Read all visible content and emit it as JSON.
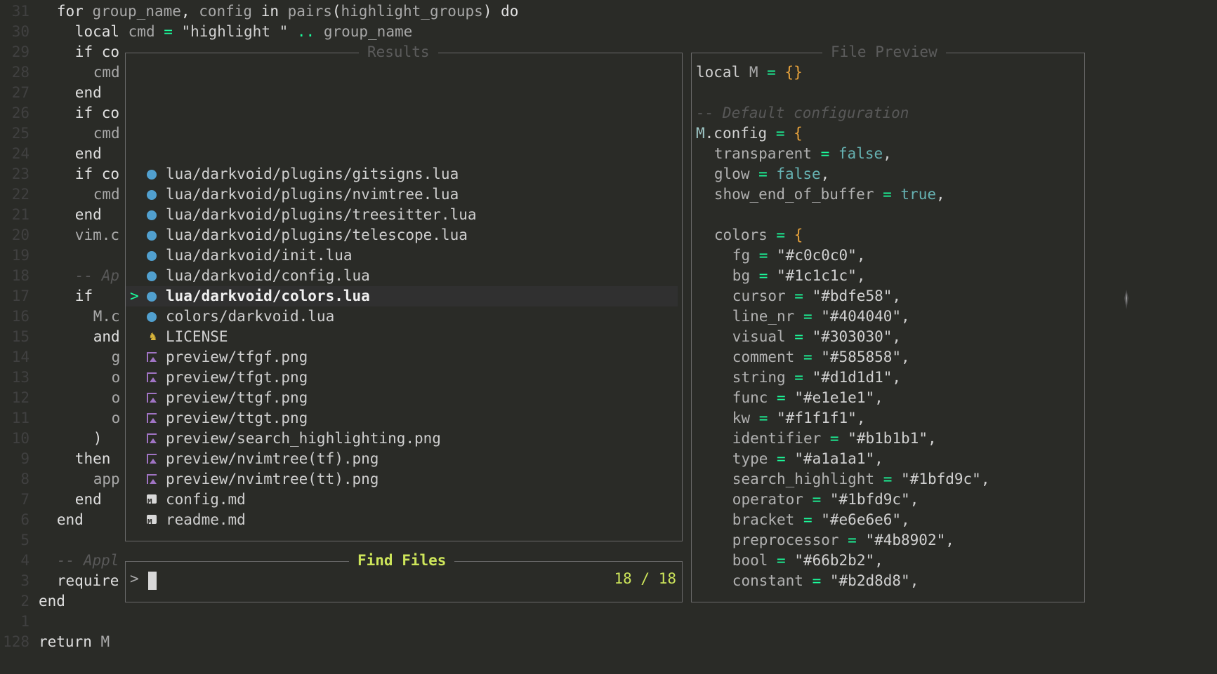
{
  "editor": {
    "lines": [
      {
        "num": "31",
        "indent": 1,
        "parts": [
          [
            "for ",
            ""
          ],
          [
            "group_name",
            "c-gray"
          ],
          [
            ", ",
            ""
          ],
          [
            "config",
            "c-gray"
          ],
          [
            " in ",
            ""
          ],
          [
            "pairs",
            "c-gray"
          ],
          [
            "(",
            ""
          ],
          [
            "highlight_groups",
            "c-gray"
          ],
          [
            ") do",
            ""
          ]
        ]
      },
      {
        "num": "30",
        "indent": 2,
        "parts": [
          [
            "local ",
            ""
          ],
          [
            "cmd",
            "c-gray"
          ],
          [
            " = ",
            "c-op"
          ],
          [
            "\"highlight \"",
            "c-str"
          ],
          [
            " .. ",
            "c-op"
          ],
          [
            "group_name",
            "c-gray"
          ]
        ]
      },
      {
        "num": "29",
        "indent": 2,
        "parts": [
          [
            "if co",
            ""
          ]
        ]
      },
      {
        "num": "28",
        "indent": 3,
        "parts": [
          [
            "cmd",
            "c-gray"
          ]
        ]
      },
      {
        "num": "27",
        "indent": 2,
        "parts": [
          [
            "end",
            ""
          ]
        ]
      },
      {
        "num": "26",
        "indent": 2,
        "parts": [
          [
            "if co",
            ""
          ]
        ]
      },
      {
        "num": "25",
        "indent": 3,
        "parts": [
          [
            "cmd",
            "c-gray"
          ]
        ]
      },
      {
        "num": "24",
        "indent": 2,
        "parts": [
          [
            "end",
            ""
          ]
        ]
      },
      {
        "num": "23",
        "indent": 2,
        "parts": [
          [
            "if co",
            ""
          ]
        ]
      },
      {
        "num": "22",
        "indent": 3,
        "parts": [
          [
            "cmd",
            "c-gray"
          ]
        ]
      },
      {
        "num": "21",
        "indent": 2,
        "parts": [
          [
            "end",
            ""
          ]
        ]
      },
      {
        "num": "20",
        "indent": 2,
        "parts": [
          [
            "vim.c",
            "c-gray"
          ]
        ]
      },
      {
        "num": "19",
        "indent": 0,
        "parts": []
      },
      {
        "num": "18",
        "indent": 2,
        "parts": [
          [
            "-- Ap",
            "c-comment"
          ]
        ]
      },
      {
        "num": "17",
        "indent": 2,
        "parts": [
          [
            "if",
            ""
          ]
        ]
      },
      {
        "num": "16",
        "indent": 3,
        "parts": [
          [
            "M.c",
            "c-gray"
          ]
        ]
      },
      {
        "num": "15",
        "indent": 3,
        "parts": [
          [
            "and",
            ""
          ]
        ]
      },
      {
        "num": "14",
        "indent": 4,
        "parts": [
          [
            "g",
            "c-gray"
          ]
        ]
      },
      {
        "num": "13",
        "indent": 4,
        "parts": [
          [
            "o",
            "c-gray"
          ]
        ]
      },
      {
        "num": "12",
        "indent": 4,
        "parts": [
          [
            "o",
            "c-gray"
          ]
        ]
      },
      {
        "num": "11",
        "indent": 4,
        "parts": [
          [
            "o",
            "c-gray"
          ]
        ]
      },
      {
        "num": "10",
        "indent": 3,
        "parts": [
          [
            ")",
            ""
          ]
        ]
      },
      {
        "num": "9",
        "indent": 2,
        "parts": [
          [
            "then",
            ""
          ]
        ]
      },
      {
        "num": "8",
        "indent": 3,
        "parts": [
          [
            "app",
            "c-gray"
          ]
        ]
      },
      {
        "num": "7",
        "indent": 2,
        "parts": [
          [
            "end",
            ""
          ]
        ]
      },
      {
        "num": "6",
        "indent": 1,
        "parts": [
          [
            "end",
            ""
          ]
        ]
      },
      {
        "num": "5",
        "indent": 0,
        "parts": []
      },
      {
        "num": "4",
        "indent": 1,
        "parts": [
          [
            "-- Appl",
            "c-comment"
          ]
        ]
      },
      {
        "num": "3",
        "indent": 1,
        "parts": [
          [
            "require",
            ""
          ]
        ]
      },
      {
        "num": "2",
        "indent": 0,
        "parts": [
          [
            "end",
            ""
          ]
        ]
      },
      {
        "num": "1",
        "indent": 0,
        "parts": []
      },
      {
        "num": "128",
        "indent": 0,
        "parts": [
          [
            "return ",
            ""
          ],
          [
            "M",
            "c-gray"
          ]
        ]
      }
    ]
  },
  "results": {
    "title": "Results",
    "selected_index": 6,
    "selection_marker": ">",
    "items": [
      {
        "icon": "lua-file-icon",
        "name": "lua/darkvoid/plugins/gitsigns.lua"
      },
      {
        "icon": "lua-file-icon",
        "name": "lua/darkvoid/plugins/nvimtree.lua"
      },
      {
        "icon": "lua-file-icon",
        "name": "lua/darkvoid/plugins/treesitter.lua"
      },
      {
        "icon": "lua-file-icon",
        "name": "lua/darkvoid/plugins/telescope.lua"
      },
      {
        "icon": "lua-file-icon",
        "name": "lua/darkvoid/init.lua"
      },
      {
        "icon": "lua-file-icon",
        "name": "lua/darkvoid/config.lua"
      },
      {
        "icon": "lua-file-icon",
        "name": "lua/darkvoid/colors.lua"
      },
      {
        "icon": "lua-file-icon",
        "name": "colors/darkvoid.lua"
      },
      {
        "icon": "license-file-icon",
        "name": "LICENSE"
      },
      {
        "icon": "image-file-icon",
        "name": "preview/tfgf.png"
      },
      {
        "icon": "image-file-icon",
        "name": "preview/tfgt.png"
      },
      {
        "icon": "image-file-icon",
        "name": "preview/ttgf.png"
      },
      {
        "icon": "image-file-icon",
        "name": "preview/ttgt.png"
      },
      {
        "icon": "image-file-icon",
        "name": "preview/search_highlighting.png"
      },
      {
        "icon": "image-file-icon",
        "name": "preview/nvimtree(tf).png"
      },
      {
        "icon": "image-file-icon",
        "name": "preview/nvimtree(tt).png"
      },
      {
        "icon": "markdown-file-icon",
        "name": "config.md"
      },
      {
        "icon": "markdown-file-icon",
        "name": "readme.md"
      }
    ]
  },
  "prompt": {
    "title": "Find Files",
    "prefix": ">",
    "value": "",
    "count": "18 / 18"
  },
  "preview": {
    "title": "File Preview",
    "lines": [
      {
        "indent": 0,
        "parts": [
          [
            "local ",
            ""
          ],
          [
            "M",
            "c-gray"
          ],
          [
            " = ",
            "c-op"
          ],
          [
            "{}",
            "c-brack"
          ]
        ]
      },
      {
        "indent": 0,
        "parts": []
      },
      {
        "indent": 0,
        "parts": [
          [
            "-- Default configuration",
            "c-comment"
          ]
        ]
      },
      {
        "indent": 0,
        "parts": [
          [
            "M",
            "c-teal"
          ],
          [
            ".config",
            ""
          ],
          [
            " = ",
            "c-op"
          ],
          [
            "{",
            "c-brack"
          ]
        ]
      },
      {
        "indent": 1,
        "parts": [
          [
            "transparent",
            "c-field"
          ],
          [
            " = ",
            "c-op"
          ],
          [
            "false",
            "c-bool"
          ],
          [
            ",",
            ""
          ]
        ]
      },
      {
        "indent": 1,
        "parts": [
          [
            "glow",
            "c-field"
          ],
          [
            " = ",
            "c-op"
          ],
          [
            "false",
            "c-bool"
          ],
          [
            ",",
            ""
          ]
        ]
      },
      {
        "indent": 1,
        "parts": [
          [
            "show_end_of_buffer",
            "c-field"
          ],
          [
            " = ",
            "c-op"
          ],
          [
            "true",
            "c-bool"
          ],
          [
            ",",
            ""
          ]
        ]
      },
      {
        "indent": 0,
        "parts": []
      },
      {
        "indent": 1,
        "parts": [
          [
            "colors",
            "c-field"
          ],
          [
            " = ",
            "c-op"
          ],
          [
            "{",
            "c-brack"
          ]
        ]
      },
      {
        "indent": 2,
        "parts": [
          [
            "fg",
            "c-field"
          ],
          [
            " = ",
            "c-op"
          ],
          [
            "\"#c0c0c0\"",
            "c-str"
          ],
          [
            ",",
            ""
          ]
        ]
      },
      {
        "indent": 2,
        "parts": [
          [
            "bg",
            "c-field"
          ],
          [
            " = ",
            "c-op"
          ],
          [
            "\"#1c1c1c\"",
            "c-str"
          ],
          [
            ",",
            ""
          ]
        ]
      },
      {
        "indent": 2,
        "parts": [
          [
            "cursor",
            "c-field"
          ],
          [
            " = ",
            "c-op"
          ],
          [
            "\"#bdfe58\"",
            "c-str"
          ],
          [
            ",",
            ""
          ]
        ]
      },
      {
        "indent": 2,
        "parts": [
          [
            "line_nr",
            "c-field"
          ],
          [
            " = ",
            "c-op"
          ],
          [
            "\"#404040\"",
            "c-str"
          ],
          [
            ",",
            ""
          ]
        ]
      },
      {
        "indent": 2,
        "parts": [
          [
            "visual",
            "c-field"
          ],
          [
            " = ",
            "c-op"
          ],
          [
            "\"#303030\"",
            "c-str"
          ],
          [
            ",",
            ""
          ]
        ]
      },
      {
        "indent": 2,
        "parts": [
          [
            "comment",
            "c-field"
          ],
          [
            " = ",
            "c-op"
          ],
          [
            "\"#585858\"",
            "c-str"
          ],
          [
            ",",
            ""
          ]
        ]
      },
      {
        "indent": 2,
        "parts": [
          [
            "string",
            "c-field"
          ],
          [
            " = ",
            "c-op"
          ],
          [
            "\"#d1d1d1\"",
            "c-str"
          ],
          [
            ",",
            ""
          ]
        ]
      },
      {
        "indent": 2,
        "parts": [
          [
            "func",
            "c-field"
          ],
          [
            " = ",
            "c-op"
          ],
          [
            "\"#e1e1e1\"",
            "c-str"
          ],
          [
            ",",
            ""
          ]
        ]
      },
      {
        "indent": 2,
        "parts": [
          [
            "kw",
            "c-field"
          ],
          [
            " = ",
            "c-op"
          ],
          [
            "\"#f1f1f1\"",
            "c-str"
          ],
          [
            ",",
            ""
          ]
        ]
      },
      {
        "indent": 2,
        "parts": [
          [
            "identifier",
            "c-field"
          ],
          [
            " = ",
            "c-op"
          ],
          [
            "\"#b1b1b1\"",
            "c-str"
          ],
          [
            ",",
            ""
          ]
        ]
      },
      {
        "indent": 2,
        "parts": [
          [
            "type",
            "c-field"
          ],
          [
            " = ",
            "c-op"
          ],
          [
            "\"#a1a1a1\"",
            "c-str"
          ],
          [
            ",",
            ""
          ]
        ]
      },
      {
        "indent": 2,
        "parts": [
          [
            "search_highlight",
            "c-field"
          ],
          [
            " = ",
            "c-op"
          ],
          [
            "\"#1bfd9c\"",
            "c-str"
          ],
          [
            ",",
            ""
          ]
        ]
      },
      {
        "indent": 2,
        "parts": [
          [
            "operator",
            "c-field"
          ],
          [
            " = ",
            "c-op"
          ],
          [
            "\"#1bfd9c\"",
            "c-str"
          ],
          [
            ",",
            ""
          ]
        ]
      },
      {
        "indent": 2,
        "parts": [
          [
            "bracket",
            "c-field"
          ],
          [
            " = ",
            "c-op"
          ],
          [
            "\"#e6e6e6\"",
            "c-str"
          ],
          [
            ",",
            ""
          ]
        ]
      },
      {
        "indent": 2,
        "parts": [
          [
            "preprocessor",
            "c-field"
          ],
          [
            " = ",
            "c-op"
          ],
          [
            "\"#4b8902\"",
            "c-str"
          ],
          [
            ",",
            ""
          ]
        ]
      },
      {
        "indent": 2,
        "parts": [
          [
            "bool",
            "c-field"
          ],
          [
            " = ",
            "c-op"
          ],
          [
            "\"#66b2b2\"",
            "c-str"
          ],
          [
            ",",
            ""
          ]
        ]
      },
      {
        "indent": 2,
        "parts": [
          [
            "constant",
            "c-field"
          ],
          [
            " = ",
            "c-op"
          ],
          [
            "\"#b2d8d8\"",
            "c-str"
          ],
          [
            ",",
            ""
          ]
        ]
      }
    ]
  },
  "theme": {
    "background": "#2a2b27",
    "accent": "#cde55a",
    "operator": "#1bfd9c",
    "line_nr": "#404040"
  }
}
